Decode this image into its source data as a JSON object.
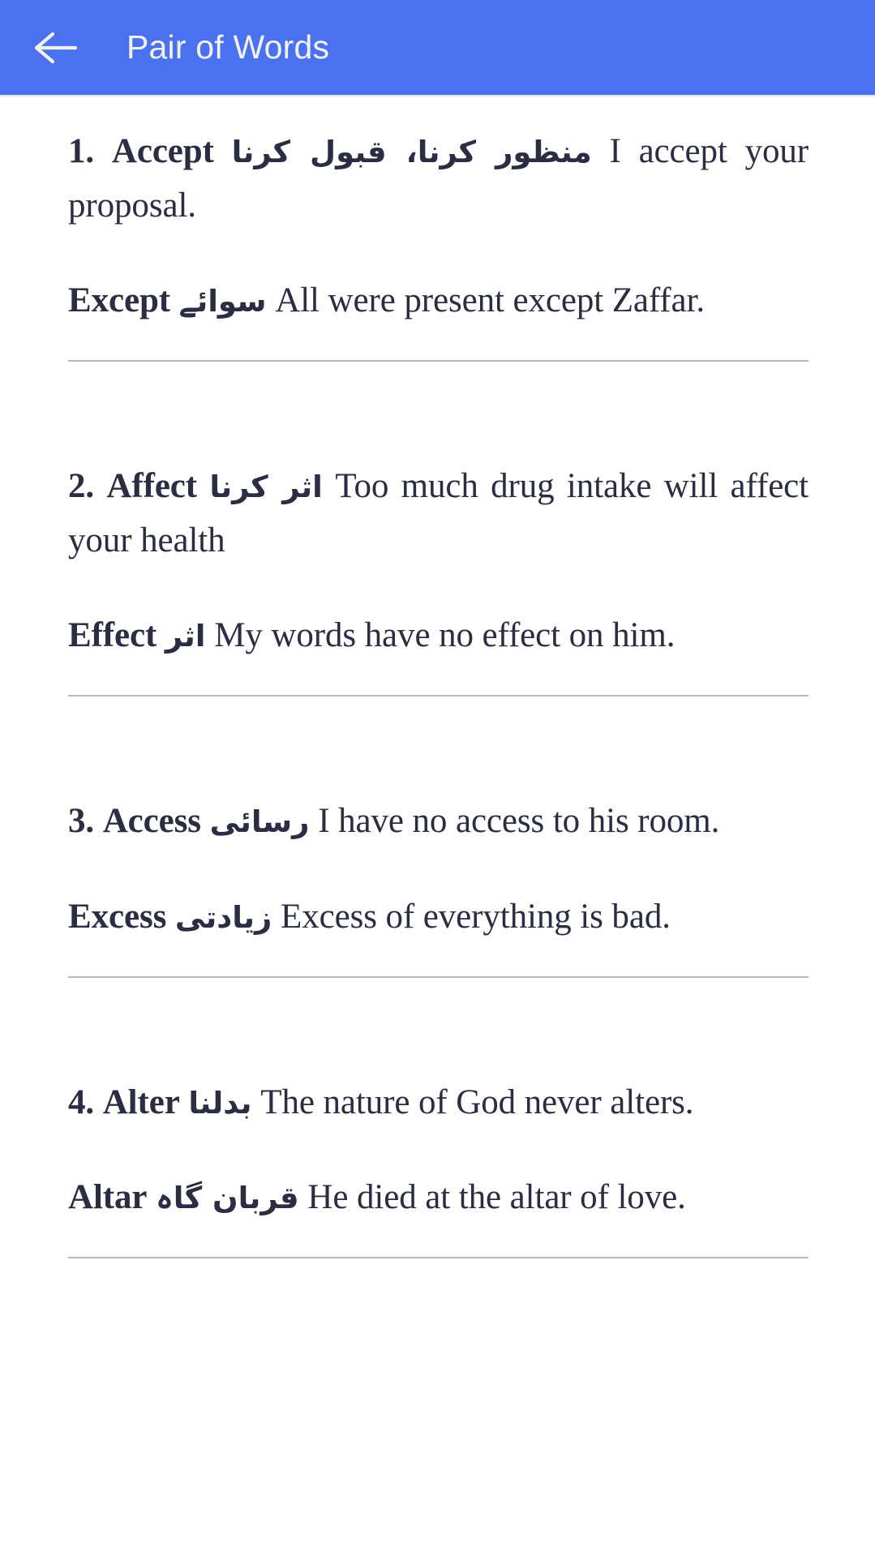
{
  "appbar": {
    "back_icon": "arrow-left-icon",
    "title": "Pair of Words",
    "background_color": "#4a72f0",
    "title_color": "#f4f1e8"
  },
  "entries": [
    {
      "number": "1.",
      "primary": {
        "term": "Accept",
        "urdu": "منظور کرنا، قبول کرنا",
        "sentence": "I accept your proposal."
      },
      "secondary": {
        "term": "Except",
        "urdu": "سوائے",
        "sentence": "All were present except Zaffar."
      }
    },
    {
      "number": "2.",
      "primary": {
        "term": "Affect",
        "urdu": "اثر کرنا",
        "sentence": "Too much drug intake will affect your health"
      },
      "secondary": {
        "term": "Effect",
        "urdu": "اثر",
        "sentence": "My words have no effect on him."
      }
    },
    {
      "number": "3.",
      "primary": {
        "term": "Access",
        "urdu": "رسائی",
        "sentence": "I have no access to his room."
      },
      "secondary": {
        "term": "Excess",
        "urdu": "زیادتی",
        "sentence": "Excess of everything is bad."
      }
    },
    {
      "number": "4.",
      "primary": {
        "term": "Alter",
        "urdu": "بدلنا",
        "sentence": "The nature of God never alters."
      },
      "secondary": {
        "term": "Altar",
        "urdu": "قربان گاہ",
        "sentence": "He died at the altar of love."
      }
    }
  ]
}
